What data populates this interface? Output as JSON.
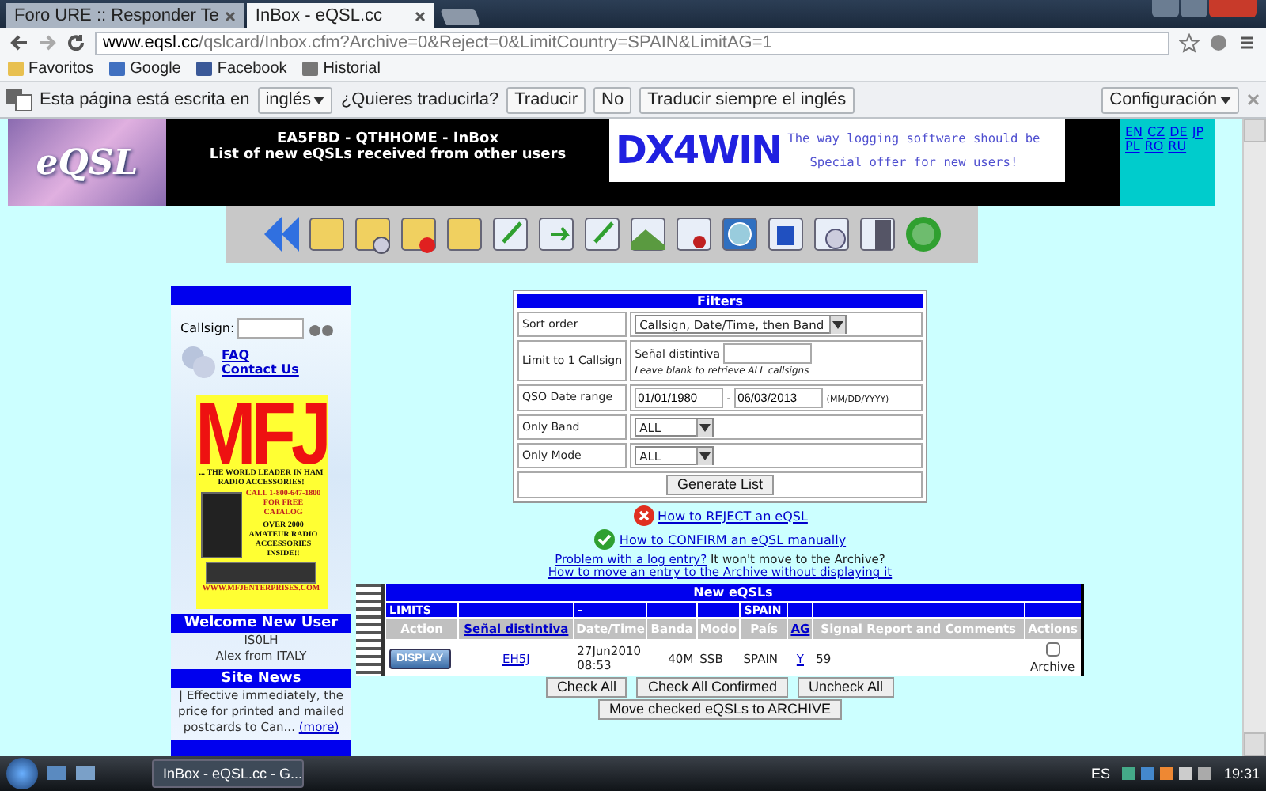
{
  "browser": {
    "tabs": [
      {
        "label": "Foro URE :: Responder Te",
        "selected": false
      },
      {
        "label": "InBox - eQSL.cc",
        "selected": true
      }
    ],
    "url_host": "www.eqsl.cc",
    "url_path": "/qslcard/Inbox.cfm?Archive=0&Reject=0&LimitCountry=SPAIN&LimitAG=1",
    "bookmarks": [
      "Favoritos",
      "Google",
      "Facebook",
      "Historial"
    ]
  },
  "translate_bar": {
    "message": "Esta página está escrita en",
    "language": "inglés",
    "question": "¿Quieres traducirla?",
    "buttons": [
      "Traducir",
      "No",
      "Traducir siempre el inglés"
    ],
    "settings": "Configuración"
  },
  "header": {
    "logo": "eQSL",
    "title": "EA5FBD - QTHHOME - InBox",
    "subtitle": "List of new eQSLs received from other users",
    "ad": {
      "brand": "DX4WIN",
      "tagline": "The way logging software should be",
      "offer": "Special offer for new users!"
    },
    "languages": [
      "EN",
      "CZ",
      "DE",
      "JP",
      "PL",
      "RO",
      "RU"
    ]
  },
  "sidebar": {
    "callsign_label": "Callsign:",
    "links": [
      "FAQ",
      "Contact Us"
    ],
    "ad": {
      "brand": "MFJ",
      "slogan": "... THE WORLD LEADER IN HAM RADIO ACCESSORIES!",
      "call": "CALL 1-800-647-1800 FOR FREE CATALOG",
      "count": "OVER 2000 AMATEUR RADIO ACCESSORIES INSIDE!!",
      "url": "WWW.MFJENTERPRISES.COM"
    },
    "welcome": {
      "title": "Welcome New User",
      "callsign": "IS0LH",
      "name": "Alex from ITALY"
    },
    "news": {
      "title": "Site News",
      "text": "| Effective immediately, the price for printed and mailed postcards to Can...",
      "more": "(more)"
    }
  },
  "filters": {
    "title": "Filters",
    "rows": [
      {
        "kind": "select",
        "label": "Sort order",
        "value": "Callsign, Date/Time, then Band"
      },
      {
        "kind": "callsign",
        "label": "Limit to 1 Callsign",
        "field_label": "Señal distintiva",
        "hint": "Leave blank to retrieve ALL callsigns"
      },
      {
        "kind": "daterange",
        "label": "QSO Date range",
        "from": "01/01/1980",
        "separator": "-",
        "to": "06/03/2013",
        "format": "(MM/DD/YYYY)"
      },
      {
        "kind": "select",
        "label": "Only Band",
        "value": "ALL"
      },
      {
        "kind": "select",
        "label": "Only Mode",
        "value": "ALL"
      },
      {
        "kind": "button",
        "label": "Generate List"
      }
    ]
  },
  "help": {
    "reject": "How to REJECT an eQSL",
    "confirm": "How to CONFIRM an eQSL manually",
    "problem_link": "Problem with a log entry?",
    "problem_text": "It won't move to the Archive?",
    "archive_link": "How to move an entry to the Archive without displaying it"
  },
  "table": {
    "title": "New eQSLs",
    "columns": [
      {
        "label": "Action",
        "limit": "LIMITS"
      },
      {
        "label": "Señal distintiva",
        "link": true
      },
      {
        "label": "Date/Time",
        "limit": "-"
      },
      {
        "label": "Banda"
      },
      {
        "label": "Modo"
      },
      {
        "label": "País",
        "limit": "SPAIN"
      },
      {
        "label": "AG",
        "link": true
      },
      {
        "label": "Signal Report and Comments"
      },
      {
        "label": "Actions"
      }
    ],
    "rows": [
      {
        "action": "DISPLAY",
        "callsign": "EH5J",
        "datetime": "27Jun2010 08:53",
        "band": "40M",
        "mode": "SSB",
        "country": "SPAIN",
        "ag": "Y",
        "report": "59",
        "archive": false,
        "archive_label": "Archive"
      }
    ]
  },
  "buttons": [
    "Check All",
    "Check All Confirmed",
    "Uncheck All"
  ],
  "move_button": "Move checked eQSLs to ARCHIVE",
  "taskbar": {
    "window": "InBox - eQSL.cc - G...",
    "language": "ES",
    "time": "19:31"
  }
}
